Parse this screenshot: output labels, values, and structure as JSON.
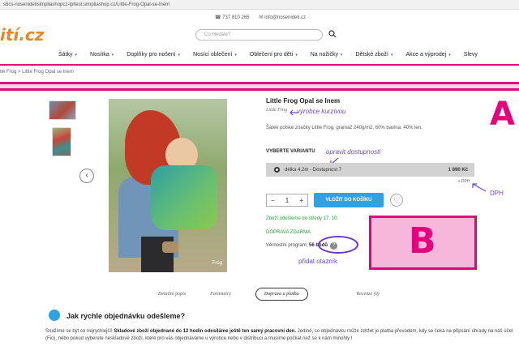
{
  "browser": {
    "url": "s5cs-nosenidetisimpliashopcz-tpltest.simpliashop.cz/Little-Frog-Opal-se-lnem"
  },
  "header": {
    "phone": "737 810 265",
    "email": "info@nosenideti.cz",
    "logo_text": "ití.cz",
    "search_placeholder": "Co hledáte?"
  },
  "nav": {
    "items": [
      "Šátky",
      "Nosítka",
      "Doplňky pro nošení",
      "Nosící oblečení",
      "Oblečení pro děti",
      "Na nožičky",
      "Dětské zboží",
      "Akce a výprodej",
      "Slevy"
    ]
  },
  "breadcrumb": "tle Frog  >  Little Frog Opal se lnem",
  "product": {
    "title": "Little Frog Opal se lnem",
    "manufacturer": "Little Frog",
    "description": "Šátek polské značky Little Frog, gramáž 240g/m2, 60% bavlna, 40% len.",
    "variant_heading": "VYBERTE VARIANTU",
    "variant_label": "délka 4,2m - Dostupnost 7",
    "variant_price": "1 890 Kč",
    "vat_note": "s DPH",
    "qty_minus": "−",
    "qty_value": "1",
    "qty_plus": "+",
    "add_to_cart": "VLOŽIT DO KOŠÍKU",
    "dispatch": "Zboží odešleme do středy 17. 10.",
    "shipping": "DOPRAVA ZDARMA",
    "loyalty_label": "Věrnostní program:",
    "loyalty_points": "56 bodů",
    "image_logo": "Frog"
  },
  "annotations": {
    "manufacturer_note": "výrobce kurzívou",
    "availability_note": "opravit dostupnosti",
    "vat_note": "DPH",
    "question_note": "přidat otazník",
    "marker_a": "A",
    "marker_b": "B"
  },
  "tabs": [
    "Detailní popis",
    "Parametry",
    "Doprava a platba",
    "Recenze (0)"
  ],
  "faq": {
    "title": "Jak rychle objednávku odešleme?",
    "text_intro": "Snažíme se být co nejrychlejší! ",
    "text_bold": "Skladové zboží objednané do 12 hodin odesíláme ještě ten samý pracovní den.",
    "text_rest": " Jediné, co objednávku může zdržet je platba převodem, kdy se čeká na připsání úhrady na náš účet (Fio), nebo pokud vyberete neskladové zboží, které pro vás objednáváme u výrobce nebo v distribuci a musíme počkat než se k nám minohly l"
  },
  "colors": {
    "accent_pink": "#e5007e",
    "annotation_purple": "#6a4cc2",
    "button_blue": "#2ea3e3",
    "green": "#2f9a3b"
  }
}
